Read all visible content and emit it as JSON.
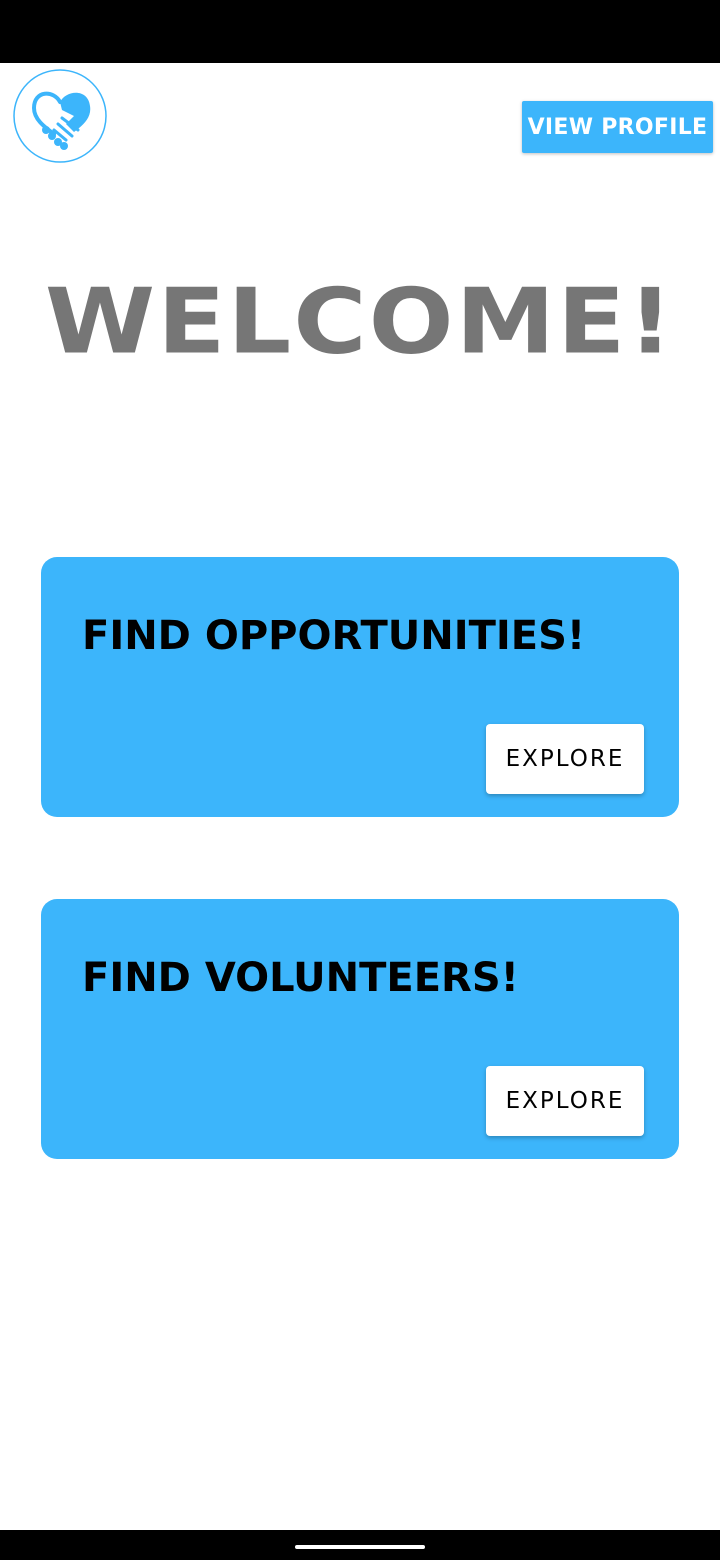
{
  "header": {
    "logo_icon": "handshake-heart-icon",
    "view_profile_label": "VIEW PROFILE"
  },
  "main": {
    "welcome_title": "WELCOME!",
    "cards": [
      {
        "title": "FIND OPPORTUNITIES!",
        "button_label": "EXPLORE"
      },
      {
        "title": "FIND VOLUNTEERS!",
        "button_label": "EXPLORE"
      }
    ]
  },
  "colors": {
    "accent": "#3cb5fb",
    "title_gray": "#767676",
    "background": "#ffffff"
  }
}
